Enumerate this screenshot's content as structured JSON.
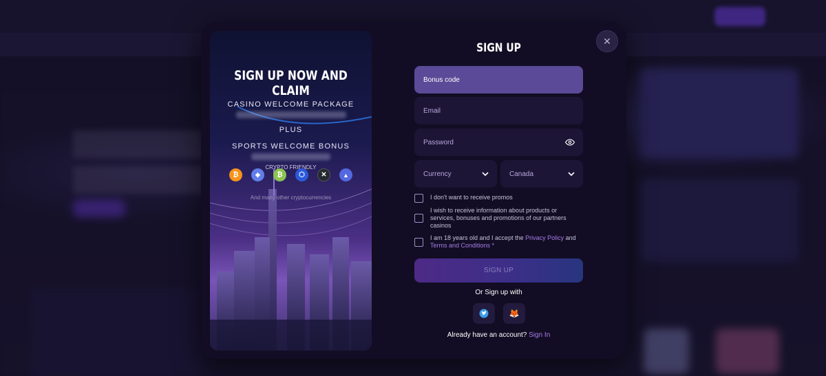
{
  "promo": {
    "title": "SIGN UP NOW AND CLAIM",
    "casino_package": "CASINO WELCOME PACKAGE",
    "plus": "PLUS",
    "sports_bonus": "SPORTS WELCOME BONUS",
    "crypto_label": "CRYPTO FRIENDLY",
    "crypto_more": "And many other cryptocurrencies",
    "coins": [
      {
        "icon": "bitcoin-icon",
        "glyph": "₿",
        "color": "#f7931a"
      },
      {
        "icon": "ethereum-icon",
        "glyph": "◆",
        "color": "#627eea"
      },
      {
        "icon": "bitcoin-cash-icon",
        "glyph": "₿",
        "color": "#8dc351"
      },
      {
        "icon": "chainlink-icon",
        "glyph": "⬡",
        "color": "#2a5ada"
      },
      {
        "icon": "ripple-icon",
        "glyph": "✕",
        "color": "#23292f"
      },
      {
        "icon": "cardano-icon",
        "glyph": "▲",
        "color": "#5468e0"
      }
    ]
  },
  "form": {
    "title": "SIGN UP",
    "bonus_placeholder": "Bonus code",
    "email_placeholder": "Email",
    "password_placeholder": "Password",
    "currency": "Currency",
    "country": "Canada",
    "checkbox_promos": "I don't want to receive promos",
    "checkbox_partners": "I wish to receive information about products or services, bonuses and promotions of our partners casinos",
    "checkbox_terms_prefix": "I am 18 years old and I accept the ",
    "privacy_policy": "Privacy Policy",
    "and": " and",
    "terms": "Terms and Conditions",
    "required_mark": " *",
    "submit": "SIGN UP",
    "or_signup": "Or Sign up with",
    "have_account": "Already have an account? ",
    "sign_in": "Sign In"
  },
  "colors": {
    "accent": "#a77de6",
    "modal_bg": "#120d24",
    "field_bg": "#1d1535",
    "active_field": "#5b4a98"
  }
}
